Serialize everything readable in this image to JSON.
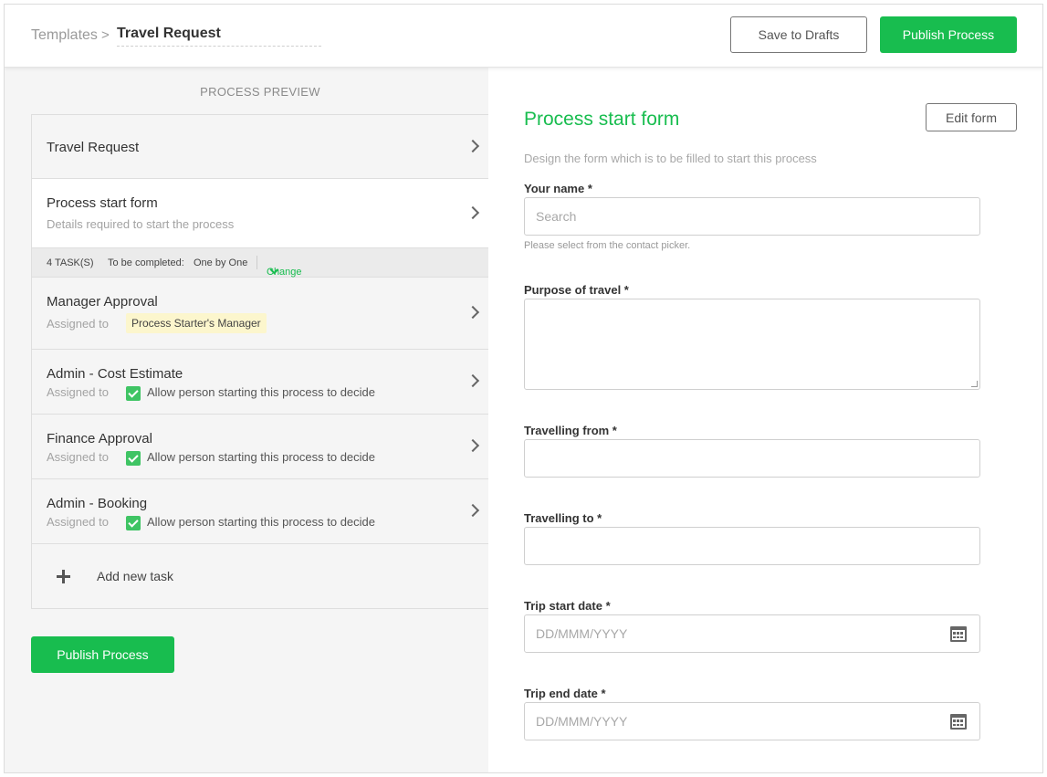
{
  "header": {
    "breadcrumb_root": "Templates",
    "breadcrumb_separator": ">",
    "breadcrumb_current": "Travel Request",
    "save_drafts_label": "Save to Drafts",
    "publish_label": "Publish Process"
  },
  "preview": {
    "heading": "PROCESS PREVIEW",
    "travel_title": "Travel Request",
    "start_form_title": "Process start form",
    "start_form_sub": "Details required to start the process",
    "task_bar": {
      "count": "4 TASK(S)",
      "completion_label": "To be completed:",
      "completion_value": "One by One",
      "change_label": "Change"
    },
    "tasks": [
      {
        "title": "Manager Approval",
        "assigned_label": "Assigned to",
        "assignee": "Process Starter's Manager"
      },
      {
        "title": "Admin - Cost Estimate",
        "assigned_label": "Assigned to",
        "assignee": "Allow person starting this process to decide"
      },
      {
        "title": "Finance Approval",
        "assigned_label": "Assigned to",
        "assignee": "Allow person starting this process to decide"
      },
      {
        "title": "Admin - Booking",
        "assigned_label": "Assigned to",
        "assignee": "Allow person starting this process to decide"
      }
    ],
    "add_task_label": "Add new task",
    "publish_label": "Publish Process"
  },
  "form": {
    "title": "Process start form",
    "edit_label": "Edit form",
    "description": "Design the form which is to be filled to start this process",
    "fields": {
      "name_label": "Your name *",
      "name_placeholder": "Search",
      "name_help": "Please select from the contact picker.",
      "purpose_label": "Purpose of travel *",
      "from_label": "Travelling from *",
      "to_label": "Travelling to *",
      "start_date_label": "Trip start date *",
      "start_date_placeholder": "DD/MMM/YYYY",
      "end_date_label": "Trip end date *",
      "end_date_placeholder": "DD/MMM/YYYY"
    }
  },
  "colors": {
    "accent": "#18bd4f",
    "badge_bg": "#fcf6cd",
    "check": "#3fc464"
  },
  "icons": [
    "chevron-right-icon",
    "chevron-down-icon",
    "checkbox-checked-icon",
    "plus-icon",
    "calendar-icon"
  ]
}
